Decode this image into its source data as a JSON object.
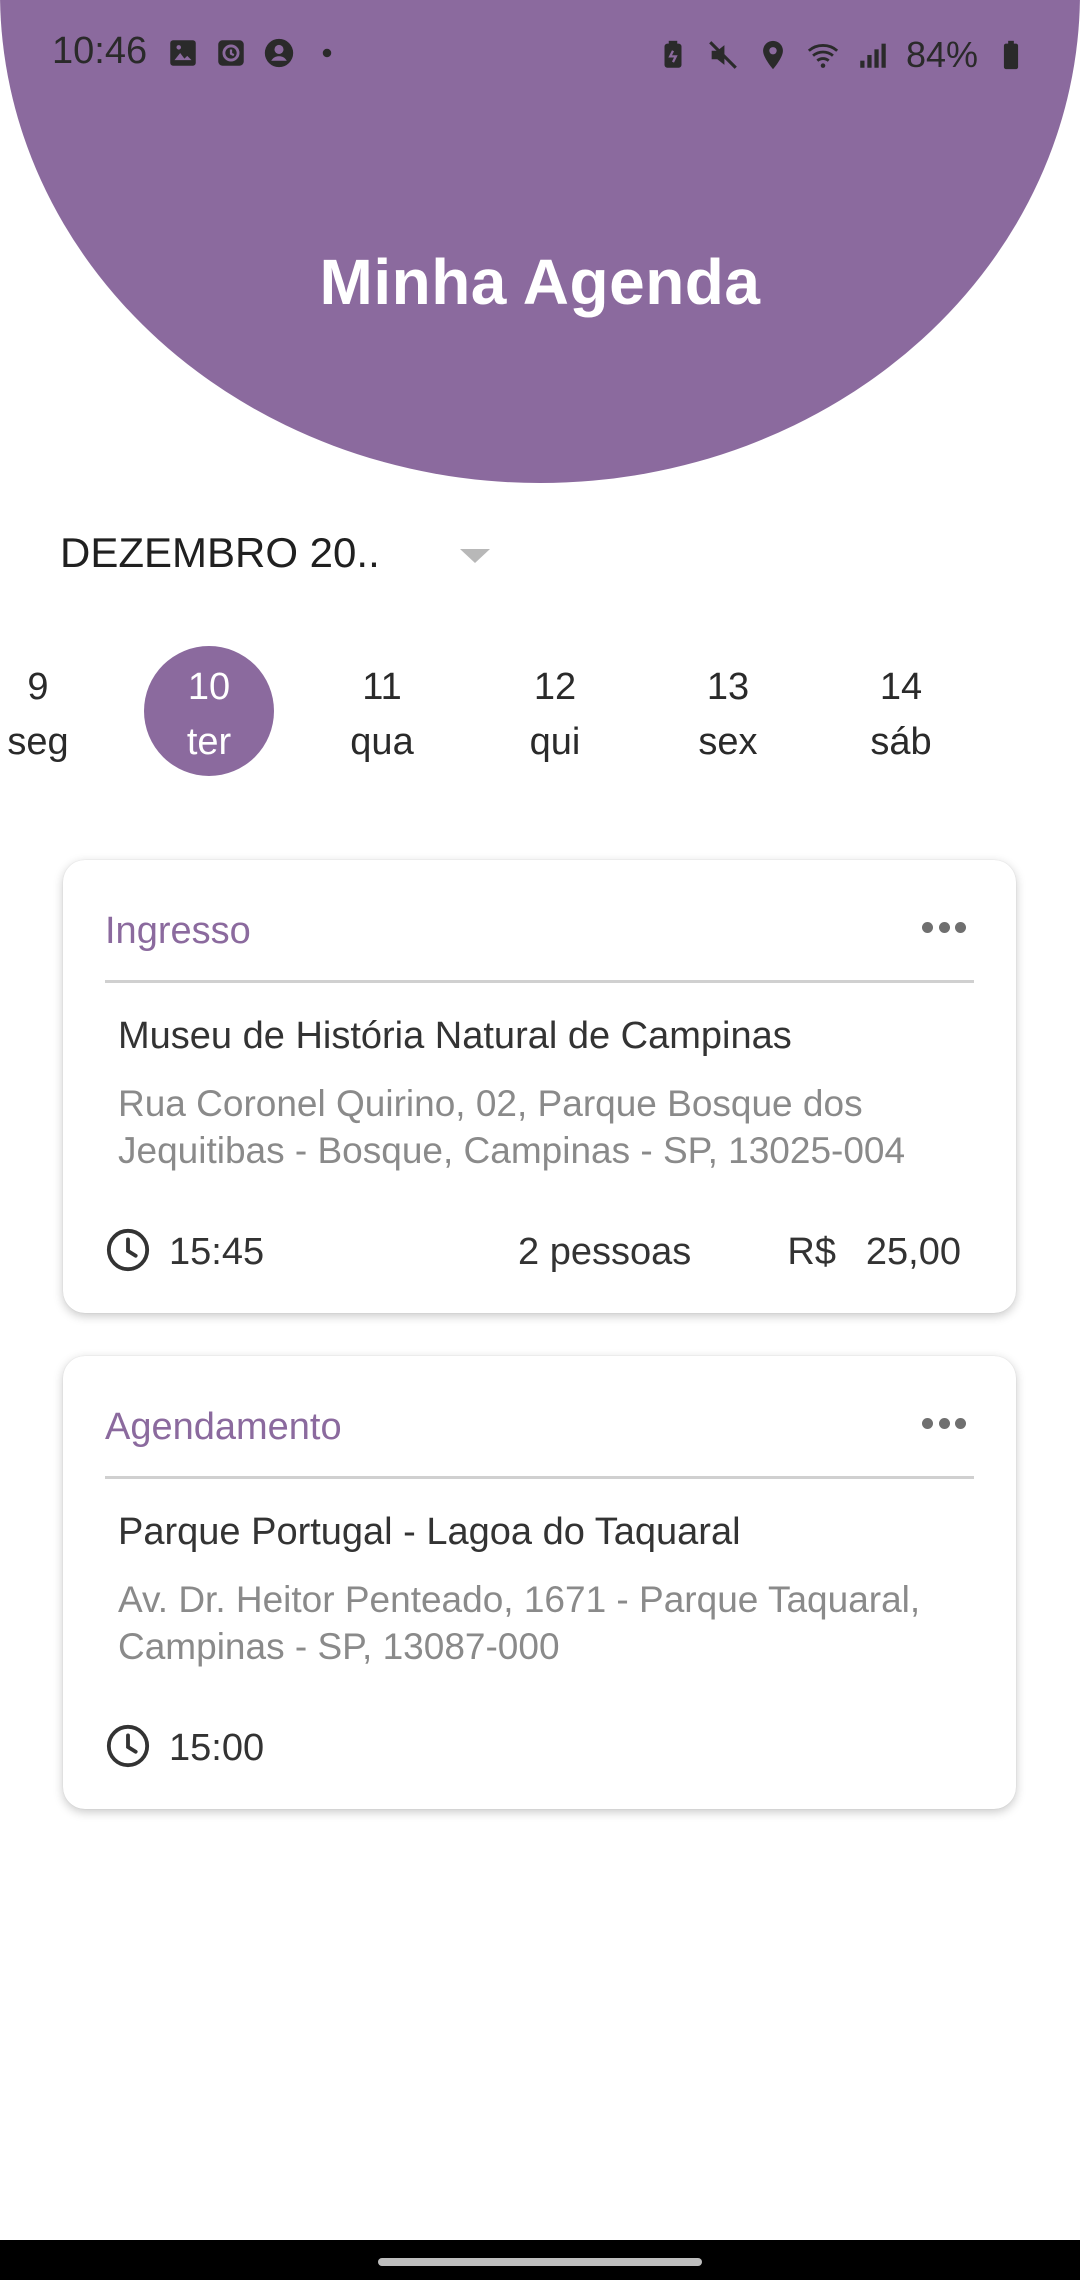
{
  "status_bar": {
    "time": "10:46",
    "battery": "84%"
  },
  "header": {
    "title": "Minha Agenda",
    "color": "#8b6a9e"
  },
  "month_selector": {
    "label": "DEZEMBRO 20.."
  },
  "days": [
    {
      "num": "9",
      "weekday": "seg",
      "selected": false
    },
    {
      "num": "10",
      "weekday": "ter",
      "selected": true
    },
    {
      "num": "11",
      "weekday": "qua",
      "selected": false
    },
    {
      "num": "12",
      "weekday": "qui",
      "selected": false
    },
    {
      "num": "13",
      "weekday": "sex",
      "selected": false
    },
    {
      "num": "14",
      "weekday": "sáb",
      "selected": false
    }
  ],
  "cards": [
    {
      "type": "Ingresso",
      "place": "Museu de História Natural de Campinas",
      "address": "Rua Coronel Quirino, 02, Parque Bosque dos Jequitibas - Bosque, Campinas - SP, 13025-004",
      "time": "15:45",
      "people": "2 pessoas",
      "currency": "R$",
      "price": "25,00"
    },
    {
      "type": "Agendamento",
      "place": "Parque Portugal - Lagoa do Taquaral",
      "address": "Av. Dr. Heitor Penteado, 1671 - Parque Taquaral, Campinas - SP, 13087-000",
      "time": "15:00"
    }
  ]
}
